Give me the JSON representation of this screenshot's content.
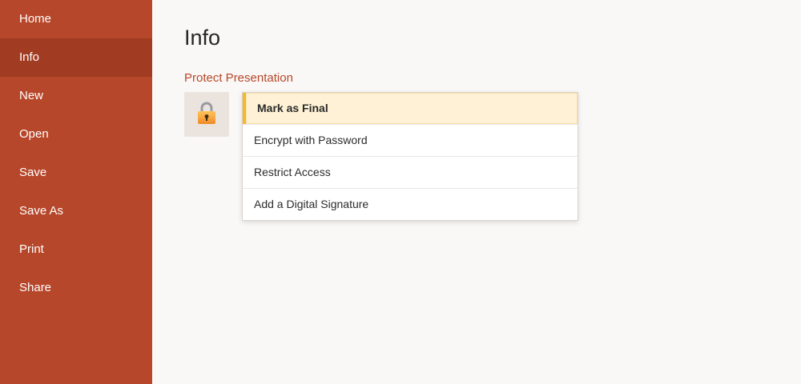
{
  "sidebar": {
    "items": [
      {
        "label": "Home",
        "active": false
      },
      {
        "label": "Info",
        "active": true
      },
      {
        "label": "New",
        "active": false
      },
      {
        "label": "Open",
        "active": false
      },
      {
        "label": "Save",
        "active": false
      },
      {
        "label": "Save As",
        "active": false
      },
      {
        "label": "Print",
        "active": false
      },
      {
        "label": "Share",
        "active": false
      }
    ]
  },
  "main": {
    "title": "Info",
    "section_heading": "Protect Presentation",
    "protect_icon": "lock-icon",
    "menu": [
      {
        "label": "Mark as Final",
        "highlighted": true
      },
      {
        "label": "Encrypt with Password",
        "highlighted": false
      },
      {
        "label": "Restrict Access",
        "highlighted": false
      },
      {
        "label": "Add a Digital Signature",
        "highlighted": false
      }
    ]
  },
  "colors": {
    "sidebar": "#b7472a",
    "sidebar_active": "#a13c22",
    "accent_text": "#b7472a",
    "highlight_bg": "#fef1d6",
    "highlight_bar": "#f2b92f"
  }
}
